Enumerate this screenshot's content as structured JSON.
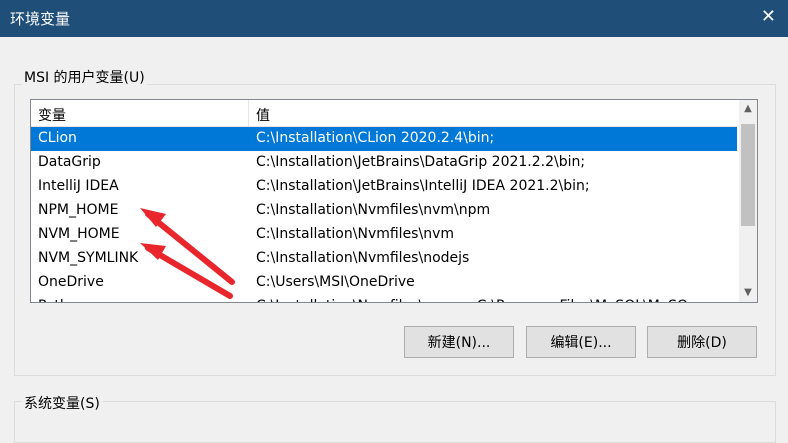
{
  "window": {
    "title": "环境变量",
    "close_glyph": "✕"
  },
  "user_group": {
    "label": "MSI 的用户变量(U)",
    "columns": {
      "name": "变量",
      "value": "值"
    },
    "rows": [
      {
        "name": "CLion",
        "value": "C:\\Installation\\CLion 2020.2.4\\bin;",
        "selected": true
      },
      {
        "name": "DataGrip",
        "value": "C:\\Installation\\JetBrains\\DataGrip 2021.2.2\\bin;"
      },
      {
        "name": "IntelliJ IDEA",
        "value": "C:\\Installation\\JetBrains\\IntelliJ IDEA 2021.2\\bin;"
      },
      {
        "name": "NPM_HOME",
        "value": "C:\\Installation\\Nvmfiles\\nvm\\npm"
      },
      {
        "name": "NVM_HOME",
        "value": "C:\\Installation\\Nvmfiles\\nvm"
      },
      {
        "name": "NVM_SYMLINK",
        "value": "C:\\Installation\\Nvmfiles\\nodejs"
      },
      {
        "name": "OneDrive",
        "value": "C:\\Users\\MSI\\OneDrive"
      },
      {
        "name": "Path",
        "value": "C:\\Installation\\Nvmfiles\\nvm;...;C:\\Program Files\\MySQL\\MySQ"
      }
    ],
    "buttons": {
      "new": "新建(N)...",
      "edit": "编辑(E)...",
      "delete": "删除(D)"
    }
  },
  "system_group": {
    "label": "系统变量(S)"
  },
  "scrollbar": {
    "up_glyph": "▲",
    "down_glyph": "▼"
  },
  "annotation_color": "#e8262b",
  "selection_color": "#0078d7",
  "titlebar_color": "#1f4e79"
}
